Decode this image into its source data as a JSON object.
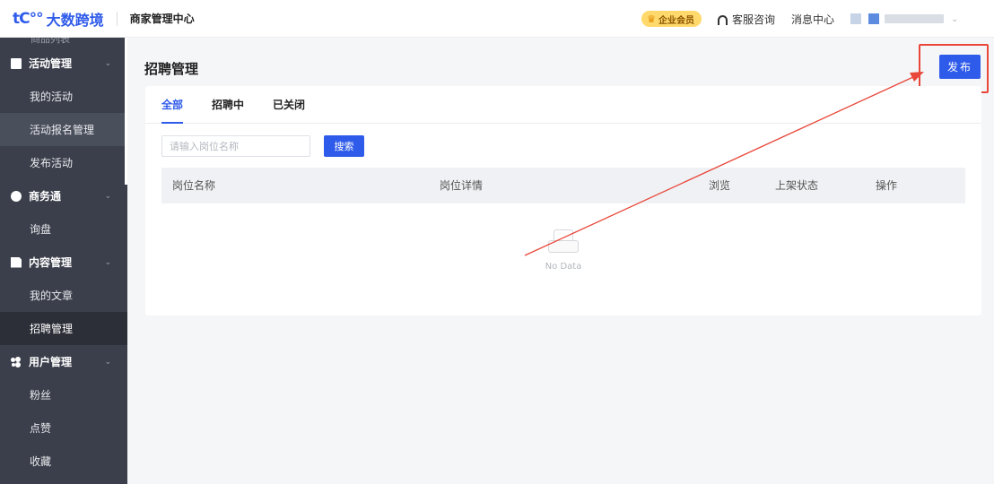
{
  "header": {
    "logo_mark": "tC°°",
    "logo_text": "大数跨境",
    "center_title": "商家管理中心",
    "vip_label": "企业会员",
    "service_link": "客服咨询",
    "message_link": "消息中心"
  },
  "sidebar": {
    "clipped_item": "商品列表",
    "groups": [
      {
        "label": "活动管理",
        "icon": "book-icon",
        "items": [
          "我的活动",
          "活动报名管理",
          "发布活动"
        ]
      },
      {
        "label": "商务通",
        "icon": "chat-icon",
        "items": [
          "询盘"
        ]
      },
      {
        "label": "内容管理",
        "icon": "document-icon",
        "items": [
          "我的文章",
          "招聘管理"
        ]
      },
      {
        "label": "用户管理",
        "icon": "users-icon",
        "items": [
          "粉丝",
          "点赞",
          "收藏"
        ]
      }
    ],
    "active_item": "招聘管理",
    "highlighted_item": "活动报名管理"
  },
  "main": {
    "page_title": "招聘管理",
    "publish_button": "发布",
    "tabs": [
      {
        "label": "全部",
        "active": true
      },
      {
        "label": "招聘中",
        "active": false
      },
      {
        "label": "已关闭",
        "active": false
      }
    ],
    "search": {
      "placeholder": "请输入岗位名称",
      "value": "",
      "button": "搜索"
    },
    "table": {
      "columns": [
        "岗位名称",
        "岗位详情",
        "浏览",
        "上架状态",
        "操作"
      ],
      "rows": []
    },
    "empty_text": "No Data"
  },
  "colors": {
    "accent": "#2f5bea",
    "sidebar_bg": "#3b3f4b",
    "annotation": "#e8473a"
  }
}
